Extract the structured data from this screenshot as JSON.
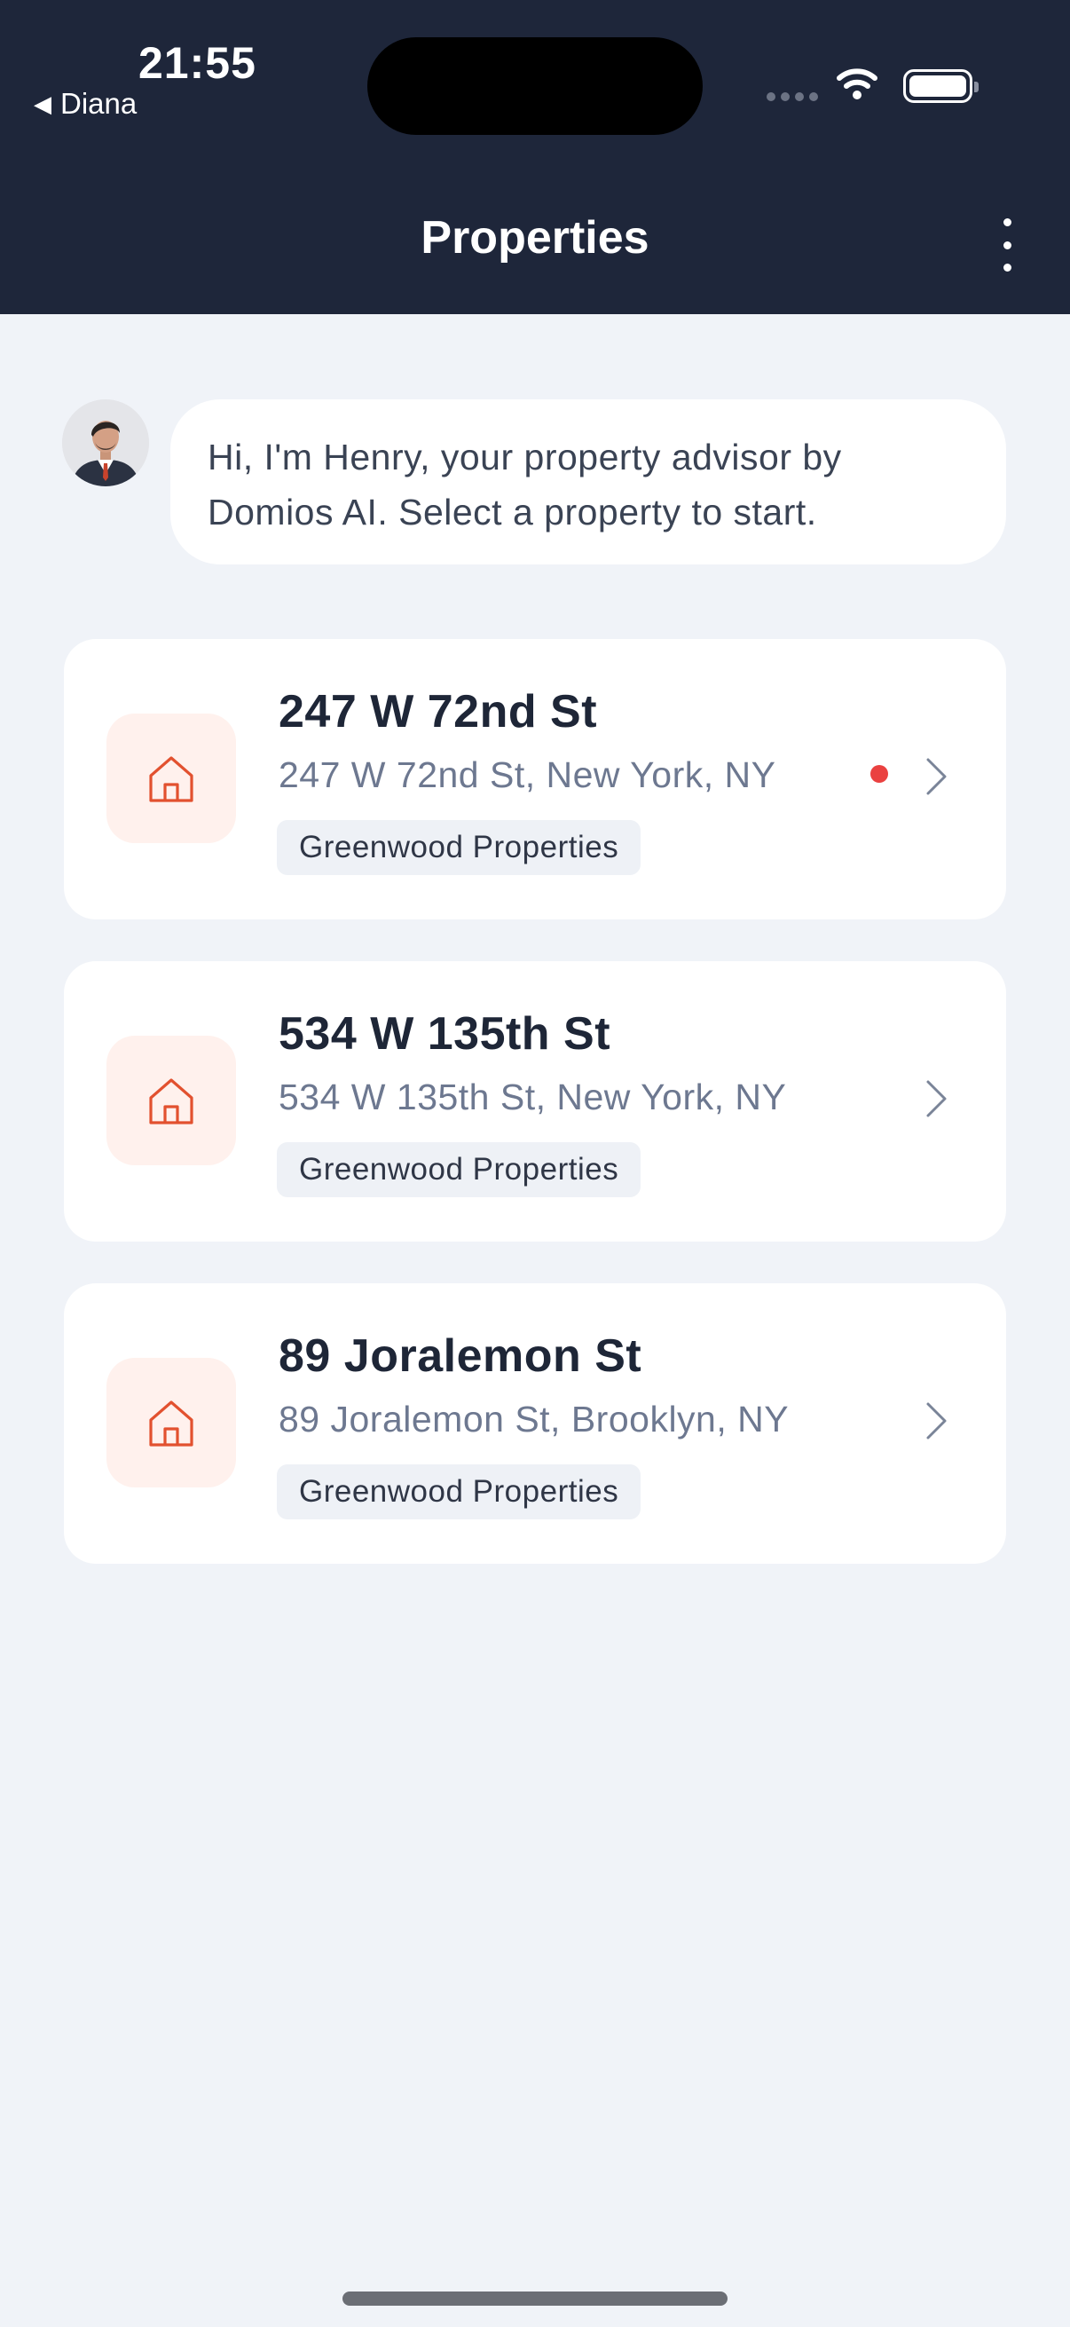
{
  "status_bar": {
    "time": "21:55",
    "back_app": "Diana",
    "back_glyph": "◀"
  },
  "header": {
    "title": "Properties"
  },
  "advisor": {
    "message": "Hi, I'm Henry, your property advisor by Domios AI. Select a property to start."
  },
  "properties": [
    {
      "name": "247 W 72nd St",
      "address": "247 W 72nd St, New York, NY",
      "company": "Greenwood Properties",
      "unread": true
    },
    {
      "name": "534 W 135th St",
      "address": "534 W 135th St, New York, NY",
      "company": "Greenwood Properties",
      "unread": false
    },
    {
      "name": "89 Joralemon St",
      "address": "89 Joralemon St, Brooklyn, NY",
      "company": "Greenwood Properties",
      "unread": false
    }
  ],
  "colors": {
    "header_bg": "#1e263a",
    "page_bg": "#f0f3f8",
    "accent": "#e2512f",
    "unread_dot": "#ea4140"
  },
  "icons": {
    "property": "house-icon",
    "open": "chevron-right-icon",
    "menu": "more-vertical-icon",
    "wifi": "wifi-icon",
    "battery": "battery-icon"
  }
}
